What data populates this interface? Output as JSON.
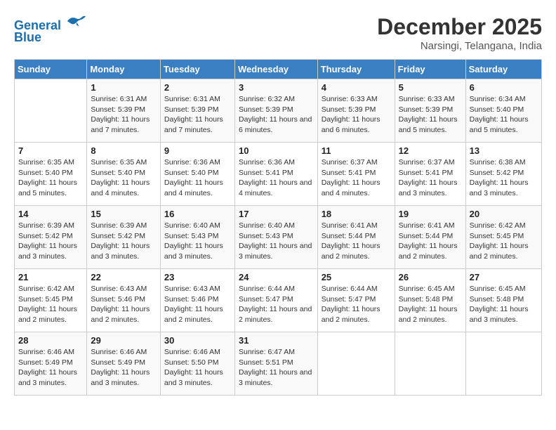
{
  "header": {
    "logo_line1": "General",
    "logo_line2": "Blue",
    "month": "December 2025",
    "location": "Narsingi, Telangana, India"
  },
  "days_of_week": [
    "Sunday",
    "Monday",
    "Tuesday",
    "Wednesday",
    "Thursday",
    "Friday",
    "Saturday"
  ],
  "weeks": [
    [
      {
        "day": "",
        "sunrise": "",
        "sunset": "",
        "daylight": ""
      },
      {
        "day": "1",
        "sunrise": "Sunrise: 6:31 AM",
        "sunset": "Sunset: 5:39 PM",
        "daylight": "Daylight: 11 hours and 7 minutes."
      },
      {
        "day": "2",
        "sunrise": "Sunrise: 6:31 AM",
        "sunset": "Sunset: 5:39 PM",
        "daylight": "Daylight: 11 hours and 7 minutes."
      },
      {
        "day": "3",
        "sunrise": "Sunrise: 6:32 AM",
        "sunset": "Sunset: 5:39 PM",
        "daylight": "Daylight: 11 hours and 6 minutes."
      },
      {
        "day": "4",
        "sunrise": "Sunrise: 6:33 AM",
        "sunset": "Sunset: 5:39 PM",
        "daylight": "Daylight: 11 hours and 6 minutes."
      },
      {
        "day": "5",
        "sunrise": "Sunrise: 6:33 AM",
        "sunset": "Sunset: 5:39 PM",
        "daylight": "Daylight: 11 hours and 5 minutes."
      },
      {
        "day": "6",
        "sunrise": "Sunrise: 6:34 AM",
        "sunset": "Sunset: 5:40 PM",
        "daylight": "Daylight: 11 hours and 5 minutes."
      }
    ],
    [
      {
        "day": "7",
        "sunrise": "Sunrise: 6:35 AM",
        "sunset": "Sunset: 5:40 PM",
        "daylight": "Daylight: 11 hours and 5 minutes."
      },
      {
        "day": "8",
        "sunrise": "Sunrise: 6:35 AM",
        "sunset": "Sunset: 5:40 PM",
        "daylight": "Daylight: 11 hours and 4 minutes."
      },
      {
        "day": "9",
        "sunrise": "Sunrise: 6:36 AM",
        "sunset": "Sunset: 5:40 PM",
        "daylight": "Daylight: 11 hours and 4 minutes."
      },
      {
        "day": "10",
        "sunrise": "Sunrise: 6:36 AM",
        "sunset": "Sunset: 5:41 PM",
        "daylight": "Daylight: 11 hours and 4 minutes."
      },
      {
        "day": "11",
        "sunrise": "Sunrise: 6:37 AM",
        "sunset": "Sunset: 5:41 PM",
        "daylight": "Daylight: 11 hours and 4 minutes."
      },
      {
        "day": "12",
        "sunrise": "Sunrise: 6:37 AM",
        "sunset": "Sunset: 5:41 PM",
        "daylight": "Daylight: 11 hours and 3 minutes."
      },
      {
        "day": "13",
        "sunrise": "Sunrise: 6:38 AM",
        "sunset": "Sunset: 5:42 PM",
        "daylight": "Daylight: 11 hours and 3 minutes."
      }
    ],
    [
      {
        "day": "14",
        "sunrise": "Sunrise: 6:39 AM",
        "sunset": "Sunset: 5:42 PM",
        "daylight": "Daylight: 11 hours and 3 minutes."
      },
      {
        "day": "15",
        "sunrise": "Sunrise: 6:39 AM",
        "sunset": "Sunset: 5:42 PM",
        "daylight": "Daylight: 11 hours and 3 minutes."
      },
      {
        "day": "16",
        "sunrise": "Sunrise: 6:40 AM",
        "sunset": "Sunset: 5:43 PM",
        "daylight": "Daylight: 11 hours and 3 minutes."
      },
      {
        "day": "17",
        "sunrise": "Sunrise: 6:40 AM",
        "sunset": "Sunset: 5:43 PM",
        "daylight": "Daylight: 11 hours and 3 minutes."
      },
      {
        "day": "18",
        "sunrise": "Sunrise: 6:41 AM",
        "sunset": "Sunset: 5:44 PM",
        "daylight": "Daylight: 11 hours and 2 minutes."
      },
      {
        "day": "19",
        "sunrise": "Sunrise: 6:41 AM",
        "sunset": "Sunset: 5:44 PM",
        "daylight": "Daylight: 11 hours and 2 minutes."
      },
      {
        "day": "20",
        "sunrise": "Sunrise: 6:42 AM",
        "sunset": "Sunset: 5:45 PM",
        "daylight": "Daylight: 11 hours and 2 minutes."
      }
    ],
    [
      {
        "day": "21",
        "sunrise": "Sunrise: 6:42 AM",
        "sunset": "Sunset: 5:45 PM",
        "daylight": "Daylight: 11 hours and 2 minutes."
      },
      {
        "day": "22",
        "sunrise": "Sunrise: 6:43 AM",
        "sunset": "Sunset: 5:46 PM",
        "daylight": "Daylight: 11 hours and 2 minutes."
      },
      {
        "day": "23",
        "sunrise": "Sunrise: 6:43 AM",
        "sunset": "Sunset: 5:46 PM",
        "daylight": "Daylight: 11 hours and 2 minutes."
      },
      {
        "day": "24",
        "sunrise": "Sunrise: 6:44 AM",
        "sunset": "Sunset: 5:47 PM",
        "daylight": "Daylight: 11 hours and 2 minutes."
      },
      {
        "day": "25",
        "sunrise": "Sunrise: 6:44 AM",
        "sunset": "Sunset: 5:47 PM",
        "daylight": "Daylight: 11 hours and 2 minutes."
      },
      {
        "day": "26",
        "sunrise": "Sunrise: 6:45 AM",
        "sunset": "Sunset: 5:48 PM",
        "daylight": "Daylight: 11 hours and 2 minutes."
      },
      {
        "day": "27",
        "sunrise": "Sunrise: 6:45 AM",
        "sunset": "Sunset: 5:48 PM",
        "daylight": "Daylight: 11 hours and 3 minutes."
      }
    ],
    [
      {
        "day": "28",
        "sunrise": "Sunrise: 6:46 AM",
        "sunset": "Sunset: 5:49 PM",
        "daylight": "Daylight: 11 hours and 3 minutes."
      },
      {
        "day": "29",
        "sunrise": "Sunrise: 6:46 AM",
        "sunset": "Sunset: 5:49 PM",
        "daylight": "Daylight: 11 hours and 3 minutes."
      },
      {
        "day": "30",
        "sunrise": "Sunrise: 6:46 AM",
        "sunset": "Sunset: 5:50 PM",
        "daylight": "Daylight: 11 hours and 3 minutes."
      },
      {
        "day": "31",
        "sunrise": "Sunrise: 6:47 AM",
        "sunset": "Sunset: 5:51 PM",
        "daylight": "Daylight: 11 hours and 3 minutes."
      },
      {
        "day": "",
        "sunrise": "",
        "sunset": "",
        "daylight": ""
      },
      {
        "day": "",
        "sunrise": "",
        "sunset": "",
        "daylight": ""
      },
      {
        "day": "",
        "sunrise": "",
        "sunset": "",
        "daylight": ""
      }
    ]
  ]
}
